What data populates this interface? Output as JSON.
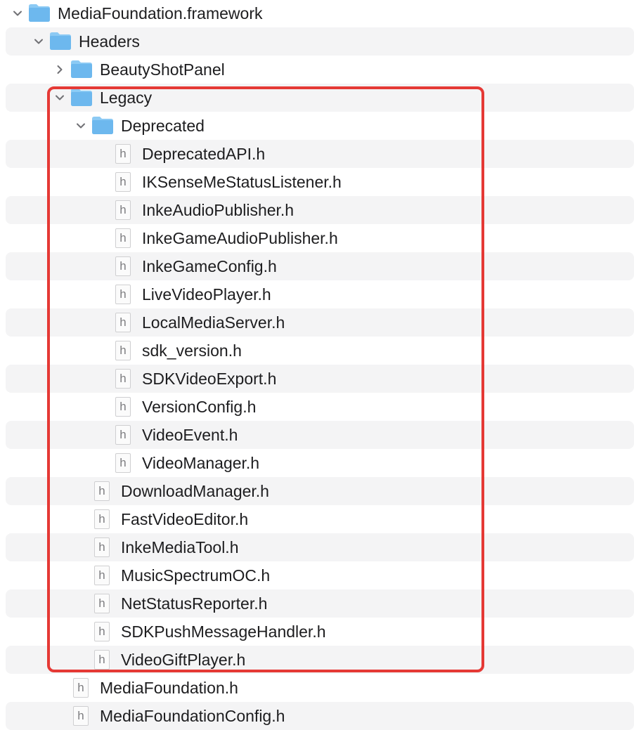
{
  "colors": {
    "folder": "#6db8ee",
    "folder_tab": "#8ccaf4",
    "highlight_border": "#e53935",
    "row_stripe": "#f4f4f5",
    "text": "#1d1d1f"
  },
  "file_icon_glyph": "h",
  "tree": [
    {
      "label": "MediaFoundation.framework",
      "kind": "folder",
      "depth": 0,
      "expanded": true
    },
    {
      "label": "Headers",
      "kind": "folder",
      "depth": 1,
      "expanded": true
    },
    {
      "label": "BeautyShotPanel",
      "kind": "folder",
      "depth": 2,
      "expanded": false
    },
    {
      "label": "Legacy",
      "kind": "folder",
      "depth": 2,
      "expanded": true
    },
    {
      "label": "Deprecated",
      "kind": "folder",
      "depth": 3,
      "expanded": true
    },
    {
      "label": "DeprecatedAPI.h",
      "kind": "file",
      "depth": 4
    },
    {
      "label": "IKSenseMeStatusListener.h",
      "kind": "file",
      "depth": 4
    },
    {
      "label": "InkeAudioPublisher.h",
      "kind": "file",
      "depth": 4
    },
    {
      "label": "InkeGameAudioPublisher.h",
      "kind": "file",
      "depth": 4
    },
    {
      "label": "InkeGameConfig.h",
      "kind": "file",
      "depth": 4
    },
    {
      "label": "LiveVideoPlayer.h",
      "kind": "file",
      "depth": 4
    },
    {
      "label": "LocalMediaServer.h",
      "kind": "file",
      "depth": 4
    },
    {
      "label": "sdk_version.h",
      "kind": "file",
      "depth": 4
    },
    {
      "label": "SDKVideoExport.h",
      "kind": "file",
      "depth": 4
    },
    {
      "label": "VersionConfig.h",
      "kind": "file",
      "depth": 4
    },
    {
      "label": "VideoEvent.h",
      "kind": "file",
      "depth": 4
    },
    {
      "label": "VideoManager.h",
      "kind": "file",
      "depth": 4
    },
    {
      "label": "DownloadManager.h",
      "kind": "file",
      "depth": 3
    },
    {
      "label": "FastVideoEditor.h",
      "kind": "file",
      "depth": 3
    },
    {
      "label": "InkeMediaTool.h",
      "kind": "file",
      "depth": 3
    },
    {
      "label": "MusicSpectrumOC.h",
      "kind": "file",
      "depth": 3
    },
    {
      "label": "NetStatusReporter.h",
      "kind": "file",
      "depth": 3
    },
    {
      "label": "SDKPushMessageHandler.h",
      "kind": "file",
      "depth": 3
    },
    {
      "label": "VideoGiftPlayer.h",
      "kind": "file",
      "depth": 3
    },
    {
      "label": "MediaFoundation.h",
      "kind": "file",
      "depth": 2
    },
    {
      "label": "MediaFoundationConfig.h",
      "kind": "file",
      "depth": 2
    }
  ]
}
